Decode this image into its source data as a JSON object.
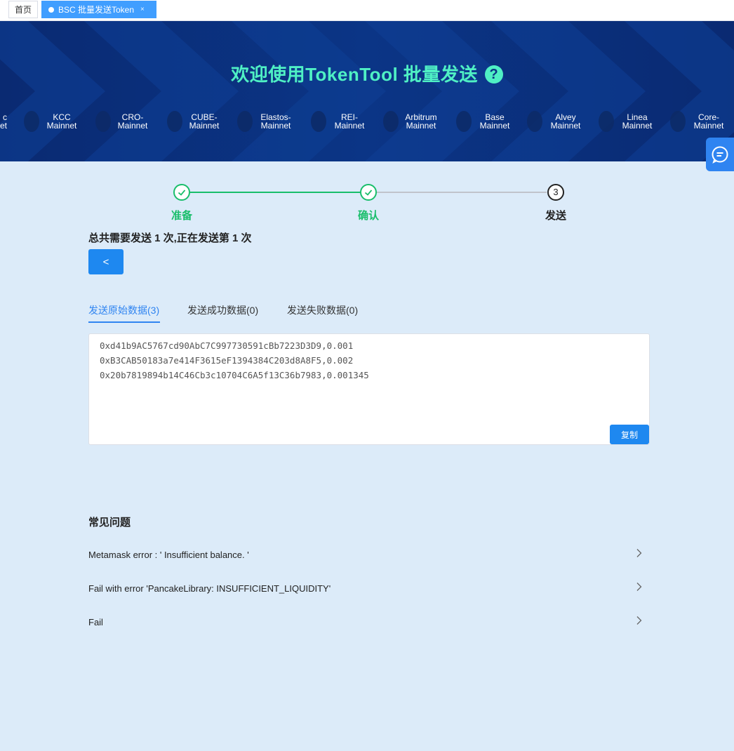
{
  "tabs": {
    "home": "首页",
    "active": "BSC 批量发送Token",
    "close": "×"
  },
  "hero": {
    "title": "欢迎使用TokenTool 批量发送",
    "help_icon": "?",
    "chains": [
      {
        "line1": "c",
        "line2": "et"
      },
      {
        "line1": "KCC",
        "line2": "Mainnet"
      },
      {
        "line1": "CRO-",
        "line2": "Mainnet"
      },
      {
        "line1": "CUBE-",
        "line2": "Mainnet"
      },
      {
        "line1": "Elastos-",
        "line2": "Mainnet"
      },
      {
        "line1": "REI-",
        "line2": "Mainnet"
      },
      {
        "line1": "Arbitrum",
        "line2": "Mainnet"
      },
      {
        "line1": "Base",
        "line2": "Mainnet"
      },
      {
        "line1": "Alvey",
        "line2": "Mainnet"
      },
      {
        "line1": "Linea",
        "line2": "Mainnet"
      },
      {
        "line1": "Core-",
        "line2": "Mainnet"
      }
    ]
  },
  "steps": [
    {
      "label": "准备",
      "state": "done"
    },
    {
      "label": "确认",
      "state": "done"
    },
    {
      "label": "发送",
      "state": "current",
      "number": "3"
    }
  ],
  "status_text": "总共需要发送 1 次,正在发送第 1 次",
  "back_button": "<",
  "subtabs": [
    {
      "label": "发送原始数据(3)",
      "active": true
    },
    {
      "label": "发送成功数据(0)",
      "active": false
    },
    {
      "label": "发送失败数据(0)",
      "active": false
    }
  ],
  "data_lines": [
    "0xd41b9AC5767cd90AbC7C997730591cBb7223D3D9,0.001",
    "0xB3CAB50183a7e414F3615eF1394384C203d8A8F5,0.002",
    "0x20b7819894b14C46Cb3c10704C6A5f13C36b7983,0.001345"
  ],
  "copy_button": "复制",
  "faq": {
    "title": "常见问题",
    "items": [
      "Metamask error : ' Insufficient balance. '",
      "Fail with error 'PancakeLibrary: INSUFFICIENT_LIQUIDITY'",
      "Fail"
    ]
  },
  "colors": {
    "accent": "#1e88f0",
    "success": "#19be6b",
    "hero_title": "#4ff0c4",
    "page_bg": "#dcebf9"
  }
}
